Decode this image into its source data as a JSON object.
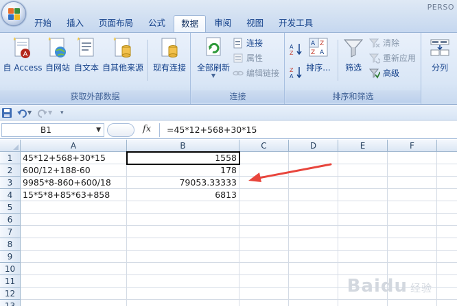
{
  "window": {
    "title": "PERSO"
  },
  "tabs": [
    "开始",
    "插入",
    "页面布局",
    "公式",
    "数据",
    "审阅",
    "视图",
    "开发工具"
  ],
  "active_tab": "数据",
  "ribbon": {
    "groups": {
      "external": {
        "label": "获取外部数据",
        "buttons": [
          "自 Access",
          "自网站",
          "自文本",
          "自其他来源",
          "现有连接"
        ]
      },
      "connections": {
        "label": "连接",
        "refresh_all": "全部刷新",
        "connect": "连接",
        "properties": "属性",
        "edit_links": "编辑链接"
      },
      "sort_filter": {
        "label": "排序和筛选",
        "sort": "排序...",
        "filter": "筛选",
        "clear": "清除",
        "reapply": "重新应用",
        "advanced": "高级"
      },
      "data_tools": {
        "split": "分列"
      }
    }
  },
  "formula_bar": {
    "name_box": "B1",
    "fx": "fx",
    "formula": "=45*12+568+30*15"
  },
  "sheet": {
    "columns": [
      "A",
      "B",
      "C",
      "D",
      "E",
      "F"
    ],
    "rows": [
      "1",
      "2",
      "3",
      "4",
      "5",
      "6",
      "7",
      "8",
      "9",
      "10",
      "11",
      "12",
      "13"
    ],
    "cells": [
      {
        "a": "45*12+568+30*15",
        "b": "1558"
      },
      {
        "a": "600/12+188-60",
        "b": "178"
      },
      {
        "a": "9985*8-860+600/18",
        "b": "79053.33333"
      },
      {
        "a": "15*5*8+85*63+858",
        "b": "6813"
      }
    ],
    "selected": "B1"
  },
  "watermark": {
    "brand": "Baidu",
    "suffix": "经验"
  },
  "colors": {
    "accent": "#15428b",
    "annotation_arrow": "#e8453c"
  }
}
